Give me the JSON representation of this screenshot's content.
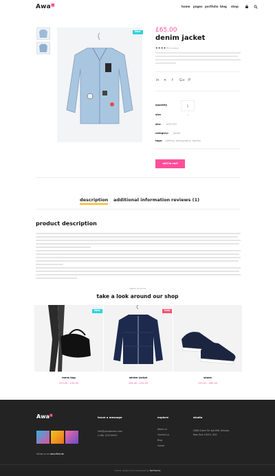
{
  "header": {
    "logo": "Awa",
    "nav": [
      "home",
      "pages",
      "portfolio",
      "blog",
      "shop"
    ],
    "icons": [
      "cart-icon",
      "search-icon"
    ]
  },
  "product": {
    "badge": "New",
    "price": "£65.00",
    "title": "denim jacket",
    "rating": 4,
    "stars": "★★★★☆",
    "reviews_count": "(3 review)",
    "quantity_label": "quantity",
    "quantity_value": "1",
    "size_label": "size",
    "size_value": "",
    "sku_label": "sku:",
    "sku_value": "AST7437",
    "category_label": "category:",
    "category_value": "jacket",
    "tags_label": "tags:",
    "tags_value": "clothing, photography, fashion",
    "add_to_cart": "add to cart",
    "accent": "#ff4f9a"
  },
  "tabs": [
    {
      "label": "description",
      "active": true
    },
    {
      "label": "additional information",
      "active": false
    },
    {
      "label": "reviews (1)",
      "active": false
    }
  ],
  "description": {
    "title": "product description"
  },
  "related": {
    "kicker": "related products",
    "title": "take a look around our shop",
    "items": [
      {
        "name": "mens bag",
        "price": "£25.00 – £35.00",
        "badge": "New"
      },
      {
        "name": "winter jacket",
        "price": "£45.00 – £55.00",
        "badge": "Sale"
      },
      {
        "name": "shoes",
        "price": "£70.00 – £85.00",
        "badge": ""
      }
    ]
  },
  "footer": {
    "logo": "Awa",
    "leave_message": "leave a message",
    "email": "info@yourdomain.com",
    "phone": "(+88) 123234929",
    "follow": "follow us on",
    "handle": "dancified.de",
    "explore": "explore",
    "explore_links": [
      "About us",
      "Contact us",
      "Blog",
      "Career"
    ],
    "studio": "studio",
    "address1": "2086 Green Ter Apt 896, Nevada,",
    "address2": "New York 10010, USA",
    "credits": "Solaris, designed and developed by ",
    "credits_brand": "YaeThemes"
  }
}
